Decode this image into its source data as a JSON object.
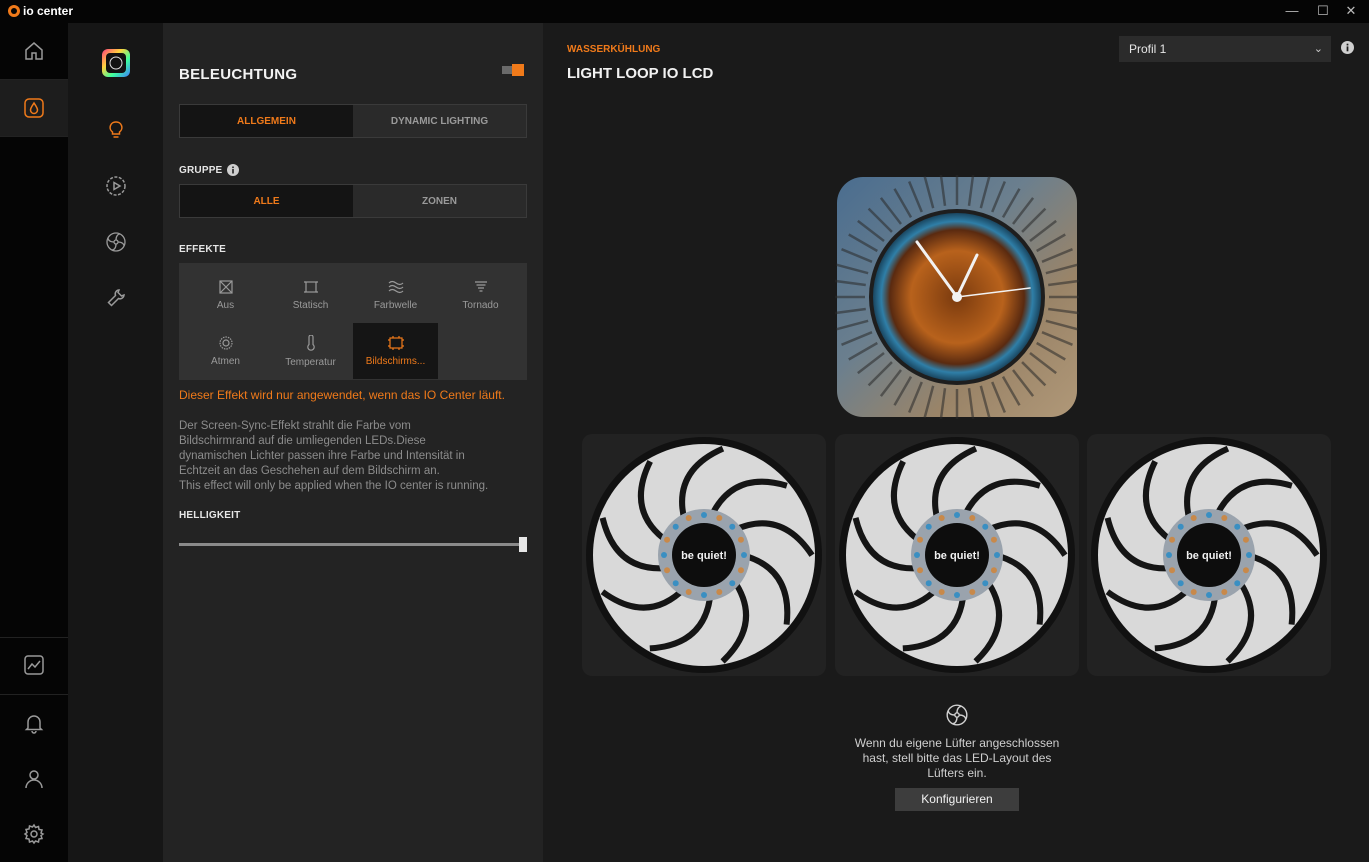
{
  "app": {
    "title": "io center"
  },
  "window": {
    "minimize": "—",
    "maximize": "☐",
    "close": "✕"
  },
  "rail": {
    "items": [
      {
        "name": "home-icon"
      },
      {
        "name": "water-drop-icon",
        "active": true
      },
      {
        "name": "chart-icon"
      },
      {
        "name": "bell-icon"
      },
      {
        "name": "user-icon"
      },
      {
        "name": "gear-icon"
      }
    ]
  },
  "subnav": {
    "items": [
      "device-thumbnail",
      "bulb-icon",
      "play-circle-icon",
      "fan-icon",
      "wrench-icon"
    ]
  },
  "lighting": {
    "title": "BELEUCHTUNG",
    "toggle_on": true,
    "tabs": [
      {
        "label": "ALLGEMEIN",
        "selected": true
      },
      {
        "label": "DYNAMIC LIGHTING",
        "selected": false
      }
    ],
    "group": {
      "label": "GRUPPE",
      "options": [
        {
          "label": "ALLE",
          "selected": true
        },
        {
          "label": "ZONEN",
          "selected": false
        }
      ]
    },
    "effects": {
      "label": "EFFEKTE",
      "items": [
        {
          "label": "Aus",
          "icon": "off-icon"
        },
        {
          "label": "Statisch",
          "icon": "static-icon"
        },
        {
          "label": "Farbwelle",
          "icon": "wave-icon"
        },
        {
          "label": "Tornado",
          "icon": "tornado-icon"
        },
        {
          "label": "Atmen",
          "icon": "breathing-icon"
        },
        {
          "label": "Temperatur",
          "icon": "thermometer-icon"
        },
        {
          "label": "Bildschirms...",
          "icon": "screen-icon",
          "selected": true
        }
      ]
    },
    "warning": "Dieser Effekt wird nur angewendet, wenn das IO Center läuft.",
    "description": "Der Screen-Sync-Effekt strahlt die Farbe vom\nBildschirmrand auf die umliegenden LEDs.Diese\ndynamischen Lichter passen ihre Farbe und Intensität in\nEchtzeit an das Geschehen auf dem Bildschirm an.\nThis effect will only be applied when the IO center is running.",
    "brightness": {
      "label": "HELLIGKEIT",
      "value": 1.0
    }
  },
  "device": {
    "category": "WASSERKÜHLUNG",
    "name": "LIGHT LOOP IO LCD",
    "profile": "Profil 1",
    "pump_time": "10:10",
    "fans": [
      {
        "brand": "be quiet!"
      },
      {
        "brand": "be quiet!"
      },
      {
        "brand": "be quiet!"
      }
    ],
    "hint": "Wenn du eigene Lüfter angeschlossen\nhast, stell bitte das LED-Layout des\nLüfters ein.",
    "configure_label": "Konfigurieren"
  },
  "colors": {
    "accent": "#f07a1a",
    "panel": "#232323",
    "main": "#1a1a1a"
  }
}
